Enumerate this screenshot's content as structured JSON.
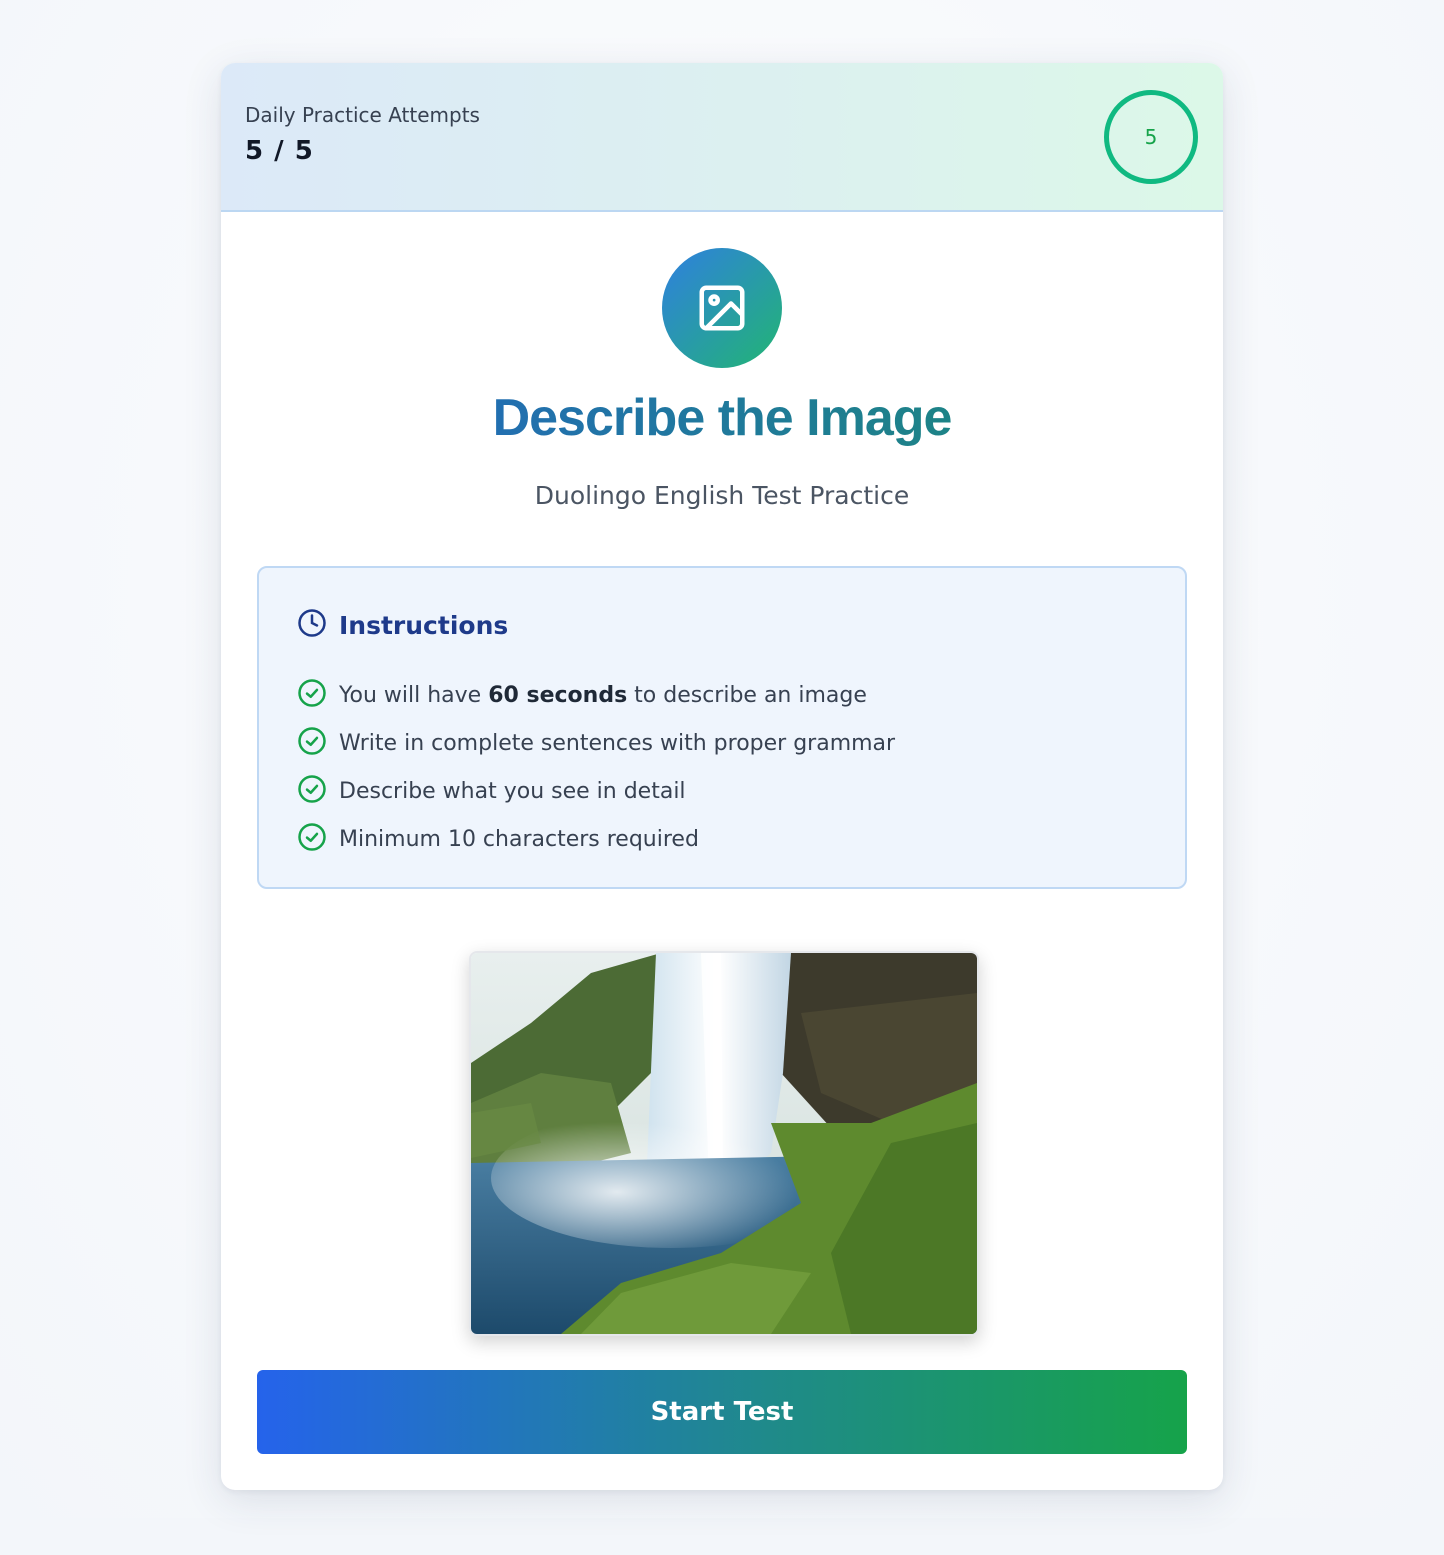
{
  "header": {
    "attempts_label": "Daily Practice Attempts",
    "attempts_count": "5 / 5",
    "remaining_badge": "5"
  },
  "hero": {
    "icon": "image-icon",
    "title": "Describe the Image",
    "subtitle": "Duolingo English Test Practice"
  },
  "instructions": {
    "heading": "Instructions",
    "heading_icon": "clock-icon",
    "rule_icon": "check-circle-icon",
    "rule1": {
      "before": "You will have ",
      "bold": "60 seconds",
      "after": " to describe an image"
    },
    "rule2": "Write in complete sentences with proper grammar",
    "rule3": "Describe what you see in detail",
    "rule4": "Minimum 10 characters required"
  },
  "photo": {
    "subject": "waterfall"
  },
  "actions": {
    "start_label": "Start Test"
  },
  "colors": {
    "accent_green": "#10b981",
    "accent_blue": "#2563eb",
    "heading_navy": "#1e3a8a"
  }
}
